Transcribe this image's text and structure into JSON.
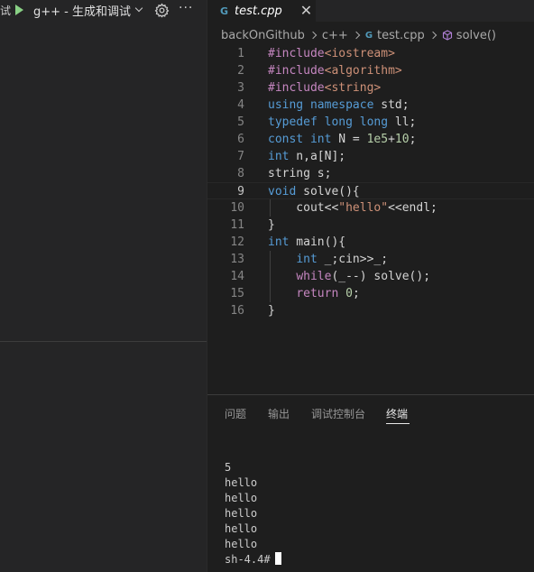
{
  "debug_toolbar": {
    "title_fragment": "试",
    "config_label": "g++ - 生成和调试",
    "play_icon": "play-icon",
    "gear_icon": "gear-icon",
    "more_label": "···"
  },
  "tabs": [
    {
      "label": "test.cpp",
      "icon": "c-file-icon",
      "icon_text": "G",
      "close": "✕"
    }
  ],
  "breadcrumb": {
    "items": [
      "backOnGithub",
      "c++",
      "test.cpp",
      "solve()"
    ],
    "file_icon_text": "G"
  },
  "editor": {
    "active_line": 9,
    "lines": [
      {
        "n": "1",
        "tokens": [
          {
            "t": "#include",
            "c": "ctl"
          },
          {
            "t": "<iostream>",
            "c": "str"
          }
        ]
      },
      {
        "n": "2",
        "tokens": [
          {
            "t": "#include",
            "c": "ctl"
          },
          {
            "t": "<algorithm>",
            "c": "str"
          }
        ]
      },
      {
        "n": "3",
        "tokens": [
          {
            "t": "#include",
            "c": "ctl"
          },
          {
            "t": "<string>",
            "c": "str"
          }
        ]
      },
      {
        "n": "4",
        "tokens": [
          {
            "t": "using",
            "c": "kw"
          },
          {
            "t": " "
          },
          {
            "t": "namespace",
            "c": "kw"
          },
          {
            "t": " std;"
          }
        ]
      },
      {
        "n": "5",
        "tokens": [
          {
            "t": "typedef",
            "c": "kw"
          },
          {
            "t": " "
          },
          {
            "t": "long",
            "c": "kw"
          },
          {
            "t": " "
          },
          {
            "t": "long",
            "c": "kw"
          },
          {
            "t": " ll;"
          }
        ]
      },
      {
        "n": "6",
        "tokens": [
          {
            "t": "const",
            "c": "kw"
          },
          {
            "t": " "
          },
          {
            "t": "int",
            "c": "kw"
          },
          {
            "t": " N = "
          },
          {
            "t": "1e5",
            "c": "num"
          },
          {
            "t": "+"
          },
          {
            "t": "10",
            "c": "num"
          },
          {
            "t": ";"
          }
        ]
      },
      {
        "n": "7",
        "tokens": [
          {
            "t": "int",
            "c": "kw"
          },
          {
            "t": " n,a[N];"
          }
        ]
      },
      {
        "n": "8",
        "tokens": [
          {
            "t": "string s;"
          }
        ]
      },
      {
        "n": "9",
        "tokens": [
          {
            "t": "void",
            "c": "kw"
          },
          {
            "t": " solve(){"
          }
        ]
      },
      {
        "n": "10",
        "tokens": [
          {
            "t": "    cout<<"
          },
          {
            "t": "\"hello\"",
            "c": "str"
          },
          {
            "t": "<<endl;"
          }
        ]
      },
      {
        "n": "11",
        "tokens": [
          {
            "t": "}"
          }
        ]
      },
      {
        "n": "12",
        "tokens": [
          {
            "t": "int",
            "c": "kw"
          },
          {
            "t": " main(){"
          }
        ]
      },
      {
        "n": "13",
        "tokens": [
          {
            "t": "    "
          },
          {
            "t": "int",
            "c": "kw"
          },
          {
            "t": " _;cin>>_;"
          }
        ]
      },
      {
        "n": "14",
        "tokens": [
          {
            "t": "    "
          },
          {
            "t": "while",
            "c": "ctl"
          },
          {
            "t": "(_--) solve();"
          }
        ]
      },
      {
        "n": "15",
        "tokens": [
          {
            "t": "    "
          },
          {
            "t": "return",
            "c": "ctl"
          },
          {
            "t": " "
          },
          {
            "t": "0",
            "c": "num"
          },
          {
            "t": ";"
          }
        ]
      },
      {
        "n": "16",
        "tokens": [
          {
            "t": "}"
          }
        ]
      }
    ]
  },
  "panel": {
    "tabs": [
      "问题",
      "输出",
      "调试控制台",
      "终端"
    ],
    "active_tab": "终端"
  },
  "terminal": {
    "lines": [
      "5",
      "hello",
      "hello",
      "hello",
      "hello",
      "hello"
    ],
    "prompt": "sh-4.4#"
  }
}
